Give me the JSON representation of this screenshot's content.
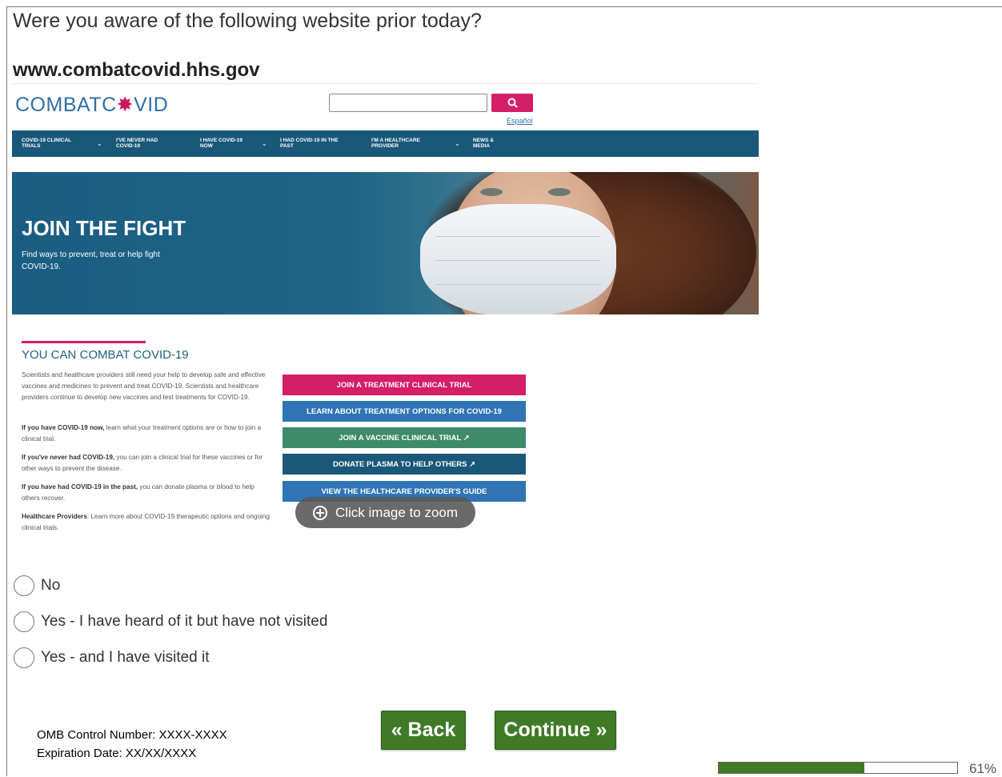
{
  "question": "Were you aware of the following website prior today?",
  "website_url": "www.combatcovid.hhs.gov",
  "site": {
    "logo_left": "COMBATC",
    "logo_virus": "✸",
    "logo_right": "VID",
    "espanol": "Español",
    "nav": [
      {
        "label": "COVID-19 CLINICAL TRIALS"
      },
      {
        "label": "I'VE NEVER HAD COVID-19"
      },
      {
        "label": "I HAVE COVID-19 NOW"
      },
      {
        "label": "I HAD COVID-19 IN THE PAST"
      },
      {
        "label": "I'M A HEALTHCARE PROVIDER"
      },
      {
        "label": "NEWS & MEDIA"
      }
    ],
    "hero_title": "JOIN THE FIGHT",
    "hero_subtitle": "Find ways to prevent, treat or help fight COVID-19.",
    "section_title": "YOU CAN COMBAT COVID-19",
    "intro": "Scientists and healthcare providers still need your help to develop safe and effective vaccines and medicines to prevent and treat COVID-19. Scientists and healthcare providers continue to develop new vaccines and test treatments for COVID-19.",
    "p1_bold": "If you have COVID-19 now,",
    "p1_text": " learn what your treatment options are or how to join a clinical trial.",
    "p2_bold": "If you've never had COVID-19,",
    "p2_text": " you can join a clinical trial for these vaccines or for other ways to prevent the disease.",
    "p3_bold": "If you have had COVID-19 in the past,",
    "p3_text": " you can donate plasma or blood to help others recover.",
    "p4_bold": "Healthcare Providers",
    "p4_text": ": Learn more about COVID-19 therapeutic options and ongoing clinical trials.",
    "buttons": [
      {
        "label": "JOIN A TREATMENT CLINICAL TRIAL",
        "color": "#d41e68"
      },
      {
        "label": "LEARN ABOUT TREATMENT OPTIONS FOR COVID-19",
        "color": "#2f74b5"
      },
      {
        "label": "JOIN A VACCINE CLINICAL TRIAL ↗",
        "color": "#3f8a6a"
      },
      {
        "label": "DONATE PLASMA TO HELP OTHERS ↗",
        "color": "#1a5879"
      },
      {
        "label": "VIEW THE HEALTHCARE PROVIDER'S GUIDE",
        "color": "#2f74b5"
      }
    ],
    "zoom_hint": "Click image to zoom"
  },
  "options": [
    {
      "label": "No"
    },
    {
      "label": "Yes - I have heard of it but have not visited"
    },
    {
      "label": "Yes - and I have visited it"
    }
  ],
  "footer": {
    "omb_line1": "OMB Control Number: XXXX-XXXX",
    "omb_line2": "Expiration Date: XX/XX/XXXX",
    "back_label": "« Back",
    "continue_label": "Continue »",
    "progress_percent": 61,
    "progress_text": "61%",
    "accent_color": "#3f7a26"
  }
}
